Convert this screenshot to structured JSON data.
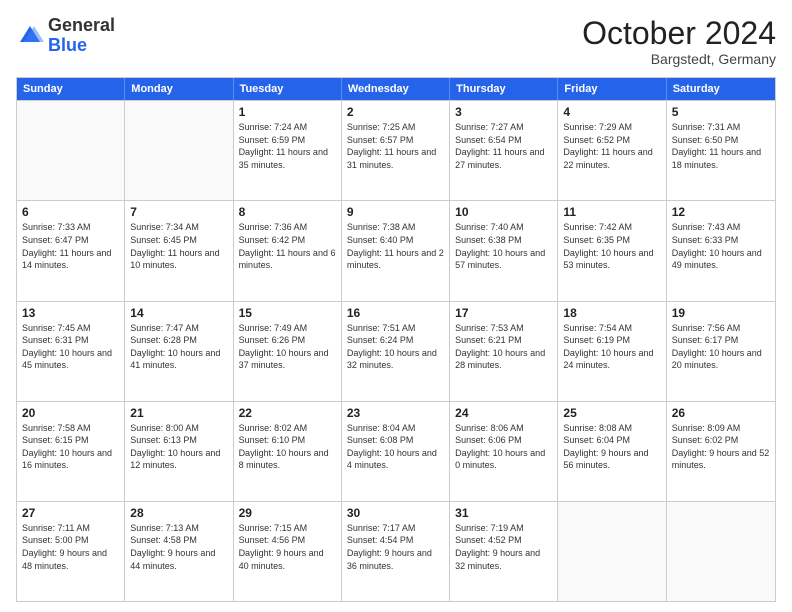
{
  "logo": {
    "general": "General",
    "blue": "Blue"
  },
  "header": {
    "month": "October 2024",
    "location": "Bargstedt, Germany"
  },
  "days": [
    "Sunday",
    "Monday",
    "Tuesday",
    "Wednesday",
    "Thursday",
    "Friday",
    "Saturday"
  ],
  "weeks": [
    [
      {
        "day": "",
        "sunrise": "",
        "sunset": "",
        "daylight": ""
      },
      {
        "day": "",
        "sunrise": "",
        "sunset": "",
        "daylight": ""
      },
      {
        "day": "1",
        "sunrise": "Sunrise: 7:24 AM",
        "sunset": "Sunset: 6:59 PM",
        "daylight": "Daylight: 11 hours and 35 minutes."
      },
      {
        "day": "2",
        "sunrise": "Sunrise: 7:25 AM",
        "sunset": "Sunset: 6:57 PM",
        "daylight": "Daylight: 11 hours and 31 minutes."
      },
      {
        "day": "3",
        "sunrise": "Sunrise: 7:27 AM",
        "sunset": "Sunset: 6:54 PM",
        "daylight": "Daylight: 11 hours and 27 minutes."
      },
      {
        "day": "4",
        "sunrise": "Sunrise: 7:29 AM",
        "sunset": "Sunset: 6:52 PM",
        "daylight": "Daylight: 11 hours and 22 minutes."
      },
      {
        "day": "5",
        "sunrise": "Sunrise: 7:31 AM",
        "sunset": "Sunset: 6:50 PM",
        "daylight": "Daylight: 11 hours and 18 minutes."
      }
    ],
    [
      {
        "day": "6",
        "sunrise": "Sunrise: 7:33 AM",
        "sunset": "Sunset: 6:47 PM",
        "daylight": "Daylight: 11 hours and 14 minutes."
      },
      {
        "day": "7",
        "sunrise": "Sunrise: 7:34 AM",
        "sunset": "Sunset: 6:45 PM",
        "daylight": "Daylight: 11 hours and 10 minutes."
      },
      {
        "day": "8",
        "sunrise": "Sunrise: 7:36 AM",
        "sunset": "Sunset: 6:42 PM",
        "daylight": "Daylight: 11 hours and 6 minutes."
      },
      {
        "day": "9",
        "sunrise": "Sunrise: 7:38 AM",
        "sunset": "Sunset: 6:40 PM",
        "daylight": "Daylight: 11 hours and 2 minutes."
      },
      {
        "day": "10",
        "sunrise": "Sunrise: 7:40 AM",
        "sunset": "Sunset: 6:38 PM",
        "daylight": "Daylight: 10 hours and 57 minutes."
      },
      {
        "day": "11",
        "sunrise": "Sunrise: 7:42 AM",
        "sunset": "Sunset: 6:35 PM",
        "daylight": "Daylight: 10 hours and 53 minutes."
      },
      {
        "day": "12",
        "sunrise": "Sunrise: 7:43 AM",
        "sunset": "Sunset: 6:33 PM",
        "daylight": "Daylight: 10 hours and 49 minutes."
      }
    ],
    [
      {
        "day": "13",
        "sunrise": "Sunrise: 7:45 AM",
        "sunset": "Sunset: 6:31 PM",
        "daylight": "Daylight: 10 hours and 45 minutes."
      },
      {
        "day": "14",
        "sunrise": "Sunrise: 7:47 AM",
        "sunset": "Sunset: 6:28 PM",
        "daylight": "Daylight: 10 hours and 41 minutes."
      },
      {
        "day": "15",
        "sunrise": "Sunrise: 7:49 AM",
        "sunset": "Sunset: 6:26 PM",
        "daylight": "Daylight: 10 hours and 37 minutes."
      },
      {
        "day": "16",
        "sunrise": "Sunrise: 7:51 AM",
        "sunset": "Sunset: 6:24 PM",
        "daylight": "Daylight: 10 hours and 32 minutes."
      },
      {
        "day": "17",
        "sunrise": "Sunrise: 7:53 AM",
        "sunset": "Sunset: 6:21 PM",
        "daylight": "Daylight: 10 hours and 28 minutes."
      },
      {
        "day": "18",
        "sunrise": "Sunrise: 7:54 AM",
        "sunset": "Sunset: 6:19 PM",
        "daylight": "Daylight: 10 hours and 24 minutes."
      },
      {
        "day": "19",
        "sunrise": "Sunrise: 7:56 AM",
        "sunset": "Sunset: 6:17 PM",
        "daylight": "Daylight: 10 hours and 20 minutes."
      }
    ],
    [
      {
        "day": "20",
        "sunrise": "Sunrise: 7:58 AM",
        "sunset": "Sunset: 6:15 PM",
        "daylight": "Daylight: 10 hours and 16 minutes."
      },
      {
        "day": "21",
        "sunrise": "Sunrise: 8:00 AM",
        "sunset": "Sunset: 6:13 PM",
        "daylight": "Daylight: 10 hours and 12 minutes."
      },
      {
        "day": "22",
        "sunrise": "Sunrise: 8:02 AM",
        "sunset": "Sunset: 6:10 PM",
        "daylight": "Daylight: 10 hours and 8 minutes."
      },
      {
        "day": "23",
        "sunrise": "Sunrise: 8:04 AM",
        "sunset": "Sunset: 6:08 PM",
        "daylight": "Daylight: 10 hours and 4 minutes."
      },
      {
        "day": "24",
        "sunrise": "Sunrise: 8:06 AM",
        "sunset": "Sunset: 6:06 PM",
        "daylight": "Daylight: 10 hours and 0 minutes."
      },
      {
        "day": "25",
        "sunrise": "Sunrise: 8:08 AM",
        "sunset": "Sunset: 6:04 PM",
        "daylight": "Daylight: 9 hours and 56 minutes."
      },
      {
        "day": "26",
        "sunrise": "Sunrise: 8:09 AM",
        "sunset": "Sunset: 6:02 PM",
        "daylight": "Daylight: 9 hours and 52 minutes."
      }
    ],
    [
      {
        "day": "27",
        "sunrise": "Sunrise: 7:11 AM",
        "sunset": "Sunset: 5:00 PM",
        "daylight": "Daylight: 9 hours and 48 minutes."
      },
      {
        "day": "28",
        "sunrise": "Sunrise: 7:13 AM",
        "sunset": "Sunset: 4:58 PM",
        "daylight": "Daylight: 9 hours and 44 minutes."
      },
      {
        "day": "29",
        "sunrise": "Sunrise: 7:15 AM",
        "sunset": "Sunset: 4:56 PM",
        "daylight": "Daylight: 9 hours and 40 minutes."
      },
      {
        "day": "30",
        "sunrise": "Sunrise: 7:17 AM",
        "sunset": "Sunset: 4:54 PM",
        "daylight": "Daylight: 9 hours and 36 minutes."
      },
      {
        "day": "31",
        "sunrise": "Sunrise: 7:19 AM",
        "sunset": "Sunset: 4:52 PM",
        "daylight": "Daylight: 9 hours and 32 minutes."
      },
      {
        "day": "",
        "sunrise": "",
        "sunset": "",
        "daylight": ""
      },
      {
        "day": "",
        "sunrise": "",
        "sunset": "",
        "daylight": ""
      }
    ]
  ]
}
